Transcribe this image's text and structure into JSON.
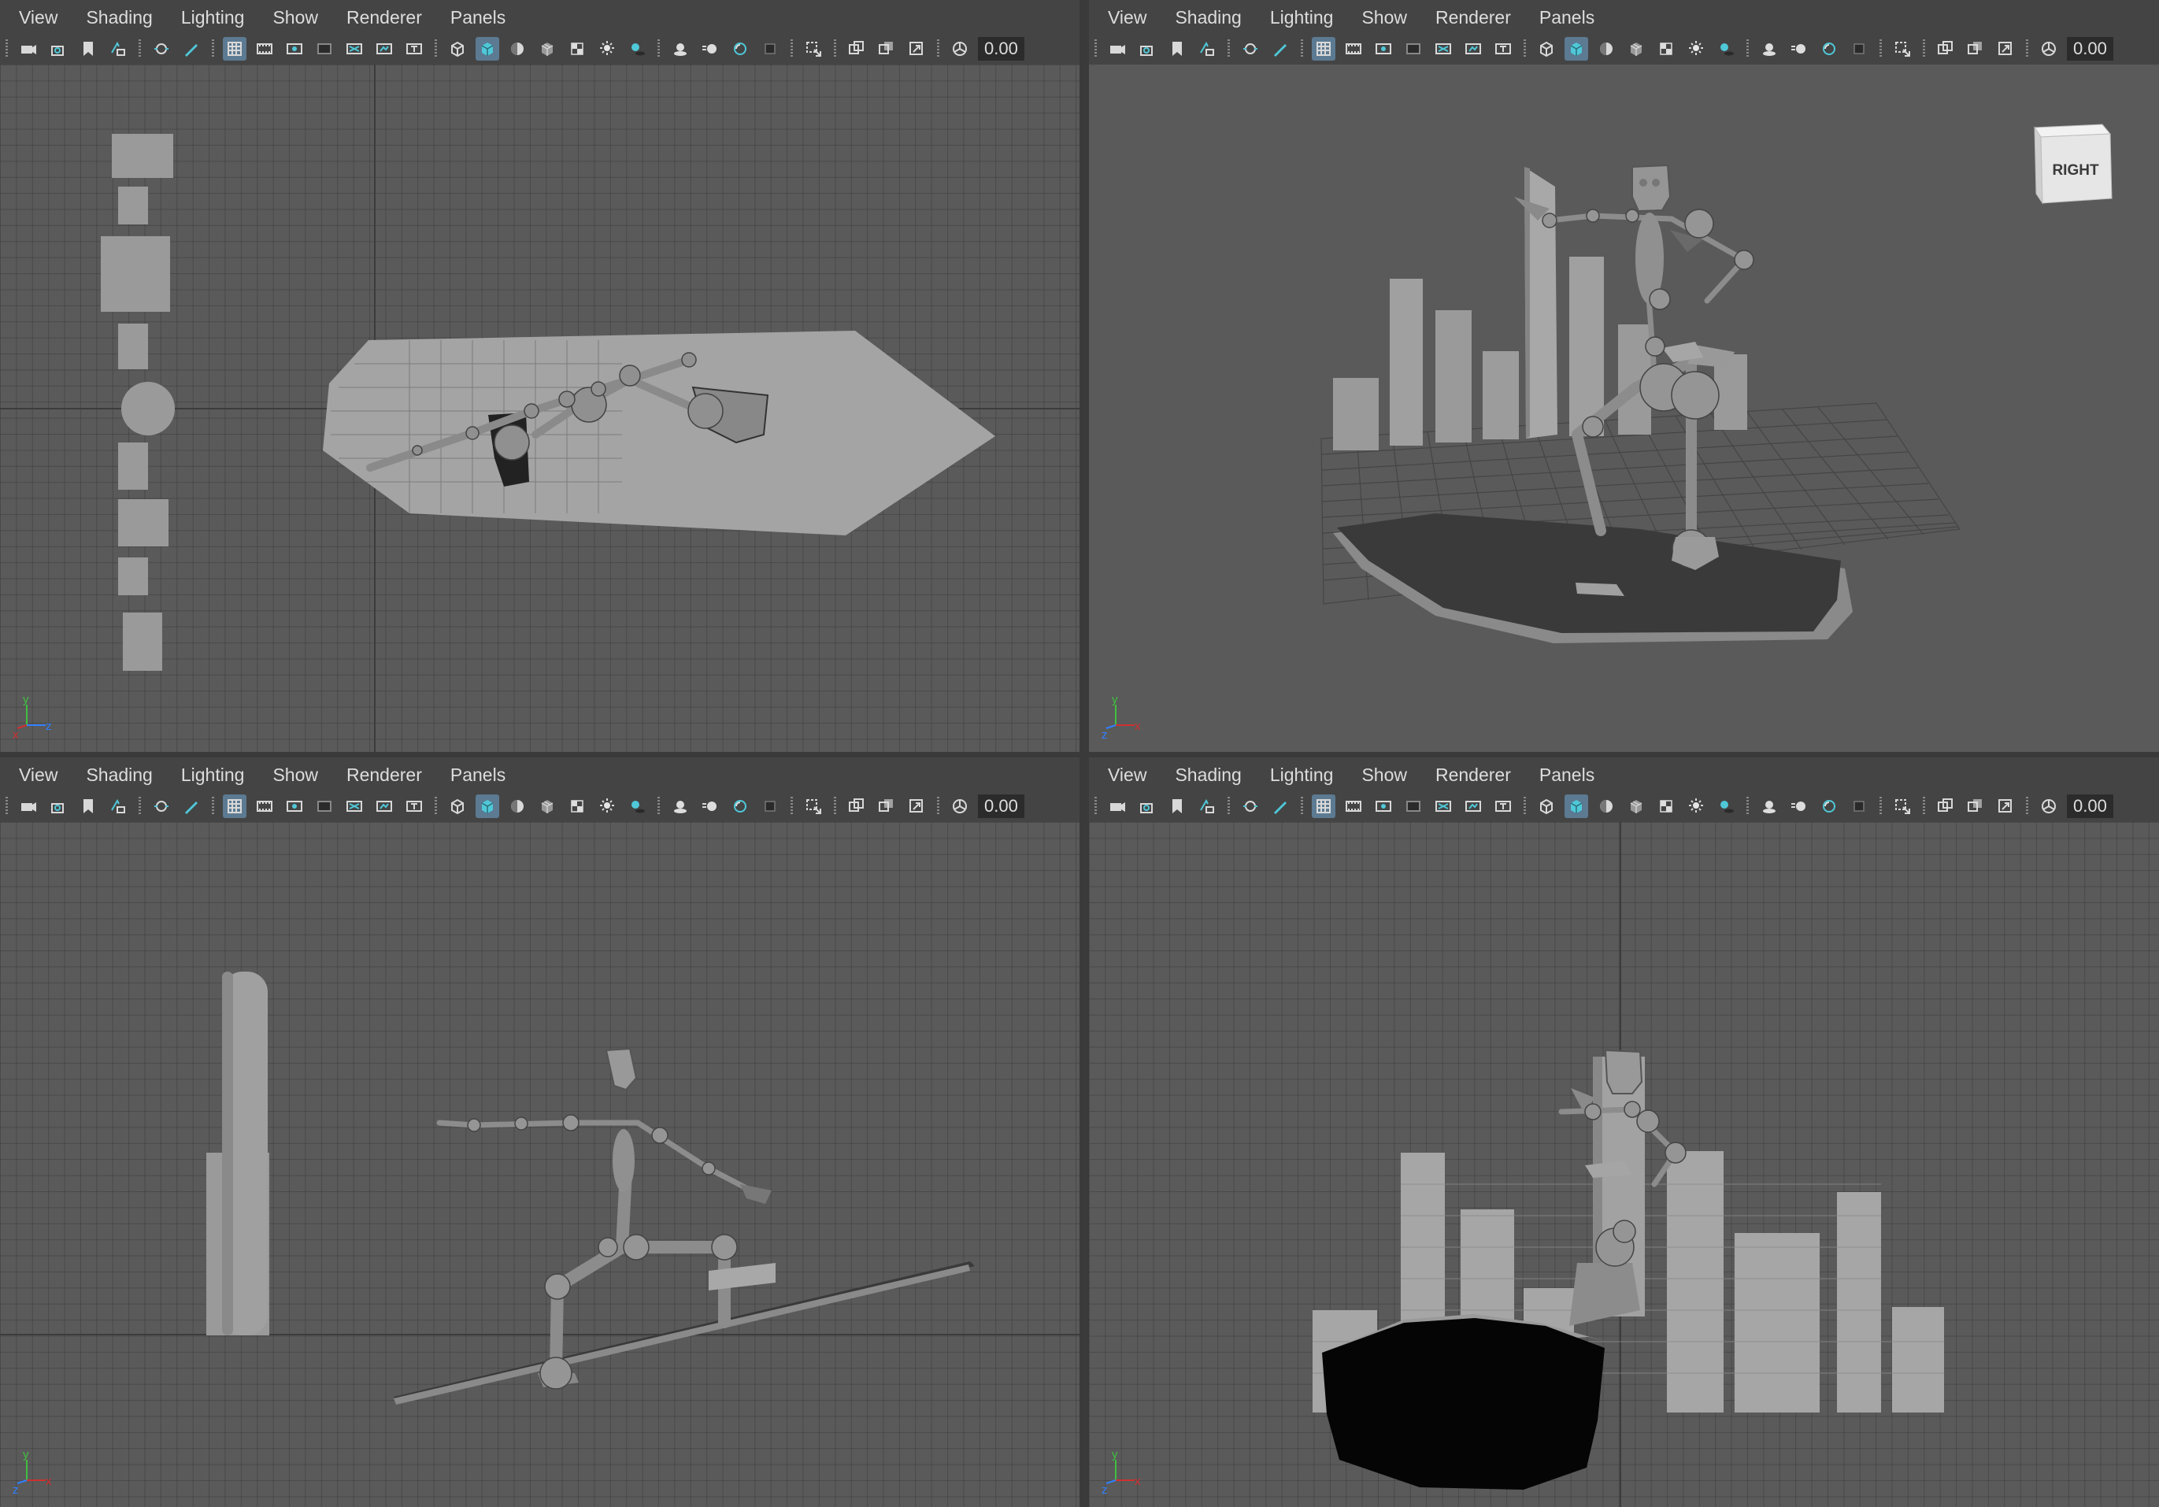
{
  "menus": [
    "View",
    "Shading",
    "Lighting",
    "Show",
    "Renderer",
    "Panels"
  ],
  "toolbar_value": "0.00",
  "toolbar_groups": [
    [
      "camera-select-icon",
      "camera-attributes-icon",
      "bookmark-icon",
      "image-plane-icon"
    ],
    [
      "2d-pan-zoom-icon",
      "grease-pencil-icon"
    ],
    [
      "grid-icon",
      "film-gate-icon",
      "resolution-gate-icon",
      "gate-mask-icon",
      "field-chart-icon",
      "safe-action-icon",
      "safe-title-icon"
    ],
    [
      "wireframe-icon",
      "smooth-shade-icon",
      "default-material-icon",
      "wireframe-on-shaded-icon",
      "textured-icon",
      "use-lights-icon",
      "shadows-icon"
    ],
    [
      "ambient-occlusion-icon",
      "motion-blur-icon",
      "anti-aliasing-icon",
      "depth-of-field-icon"
    ],
    [
      "isolate-select-icon"
    ],
    [
      "xray-icon",
      "xray-joints-icon",
      "xray-active-icon"
    ],
    [
      "exposure-icon"
    ]
  ],
  "active_toolbar_icons": [
    "grid-icon",
    "smooth-shade-icon"
  ],
  "panels": [
    {
      "id": "top",
      "axes": [
        "y",
        "x",
        "z"
      ],
      "view_cube": null
    },
    {
      "id": "persp",
      "axes": [
        "y",
        "z",
        "x"
      ],
      "view_cube": "RIGHT"
    },
    {
      "id": "side",
      "axes": [
        "y",
        "z",
        "x"
      ],
      "view_cube": null
    },
    {
      "id": "front",
      "axes": [
        "y",
        "z",
        "x"
      ],
      "view_cube": null
    }
  ],
  "colors": {
    "viewport_bg": "#5a5a5a",
    "mesh_gray": "#9a9a9a",
    "dark_mesh": "#1a1a1a",
    "axis_x": "#d03030",
    "axis_y": "#40c040",
    "axis_z": "#3080ff",
    "active_button": "#5c7a92",
    "accent_icon": "#4fc8d8"
  }
}
